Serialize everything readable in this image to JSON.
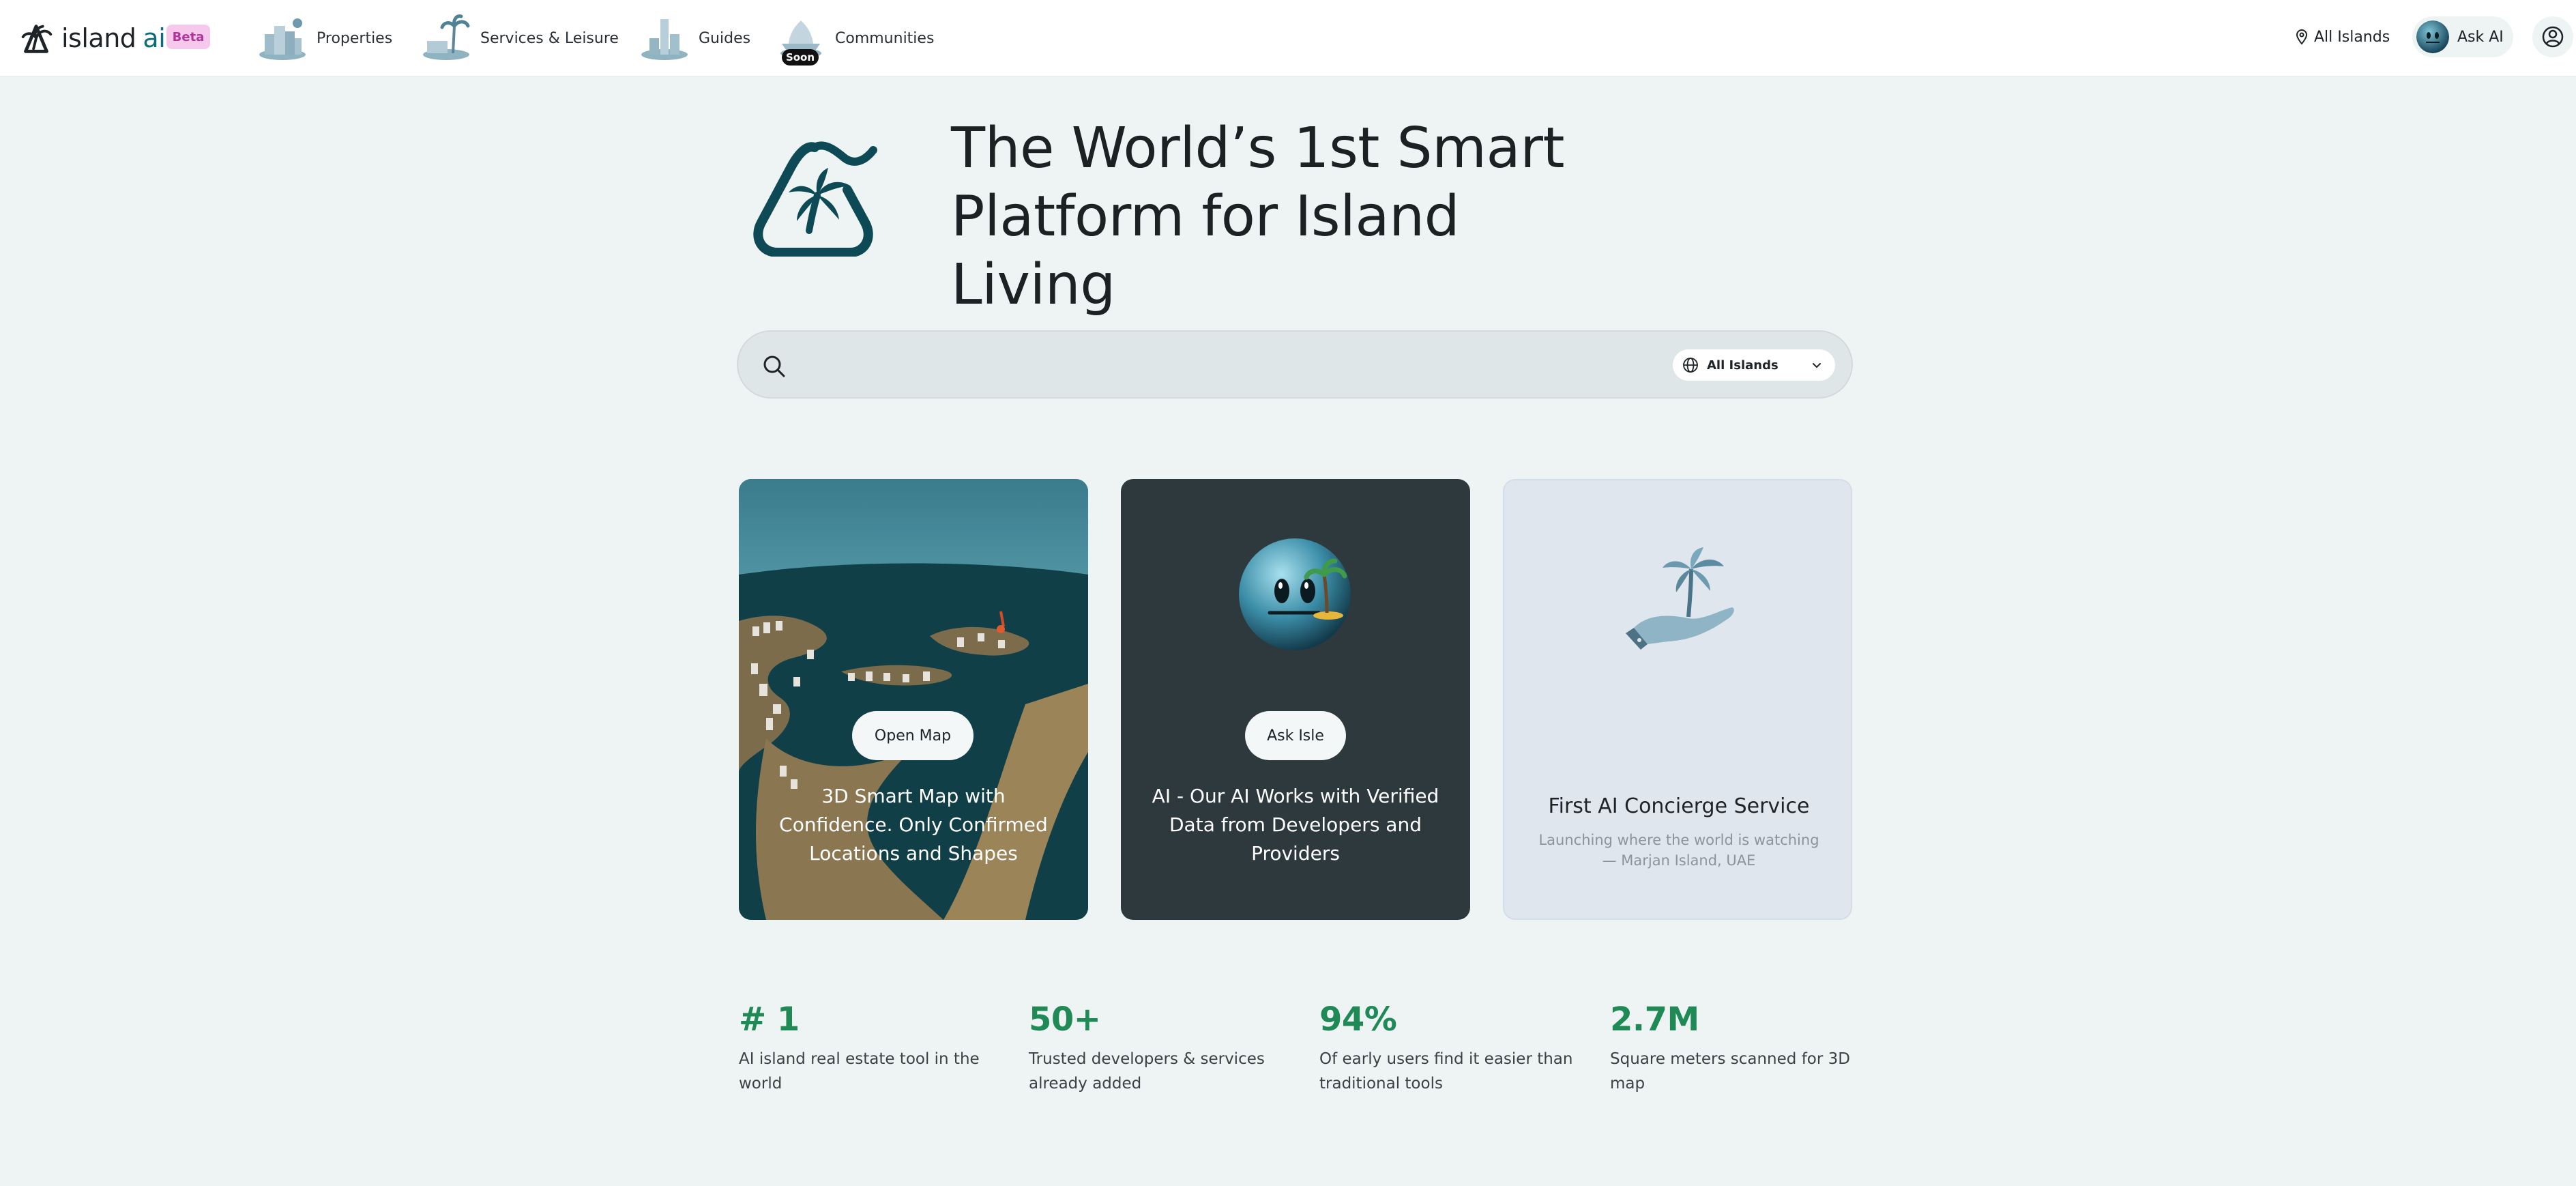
{
  "header": {
    "logo_text": "island",
    "logo_ai": "ai",
    "beta_badge": "Beta",
    "nav": [
      {
        "label": "Properties",
        "icon": "buildings-icon"
      },
      {
        "label": "Services & Leisure",
        "icon": "palm-island-icon"
      },
      {
        "label": "Guides",
        "icon": "tower-icon"
      },
      {
        "label": "Communities",
        "icon": "ship-icon",
        "badge": "Soon"
      }
    ],
    "location": "All Islands",
    "ask_ai": "Ask AI"
  },
  "hero": {
    "title_line1": "The World’s 1st Smart",
    "title_line2": "Platform for Island Living"
  },
  "search": {
    "placeholder": "",
    "value": "",
    "island_select": "All Islands"
  },
  "cards": [
    {
      "button": "Open Map",
      "text": "3D Smart Map with Confidence. Only Confirmed Locations and Shapes"
    },
    {
      "button": "Ask Isle",
      "text": "AI - Our AI Works with Verified Data from Developers and Providers"
    },
    {
      "title": "First AI Concierge Service",
      "subtitle": "Launching where the world is watching — Marjan Island, UAE"
    }
  ],
  "stats": [
    {
      "value": "# 1",
      "desc": "AI island real estate tool in the world"
    },
    {
      "value": "50+",
      "desc": "Trusted developers & services already added"
    },
    {
      "value": "94%",
      "desc": "Of early users find it easier than traditional tools"
    },
    {
      "value": "2.7M",
      "desc": "Square meters scanned for 3D map"
    }
  ],
  "colors": {
    "accent_green": "#1f8a55",
    "brand_teal": "#0f6b7a",
    "beta_pink": "#f6c9ec",
    "dark_card": "#2e393e",
    "page_bg": "#eef4f4"
  }
}
